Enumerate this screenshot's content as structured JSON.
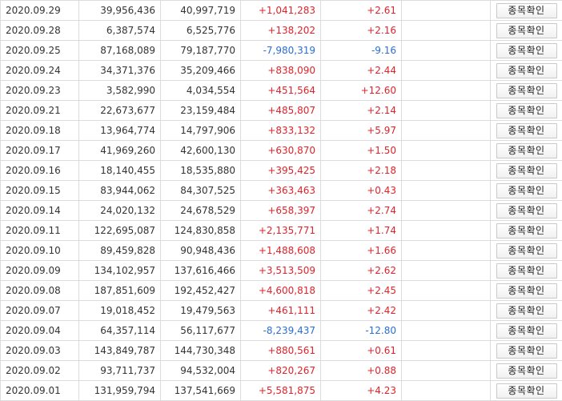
{
  "table": {
    "button_label": "종목확인",
    "rows": [
      {
        "date": "2020.09.29",
        "v1": "39,956,436",
        "v2": "40,997,719",
        "change": "+1,041,283",
        "rate": "+2.61",
        "dir": "pos"
      },
      {
        "date": "2020.09.28",
        "v1": "6,387,574",
        "v2": "6,525,776",
        "change": "+138,202",
        "rate": "+2.16",
        "dir": "pos"
      },
      {
        "date": "2020.09.25",
        "v1": "87,168,089",
        "v2": "79,187,770",
        "change": "-7,980,319",
        "rate": "-9.16",
        "dir": "neg"
      },
      {
        "date": "2020.09.24",
        "v1": "34,371,376",
        "v2": "35,209,466",
        "change": "+838,090",
        "rate": "+2.44",
        "dir": "pos"
      },
      {
        "date": "2020.09.23",
        "v1": "3,582,990",
        "v2": "4,034,554",
        "change": "+451,564",
        "rate": "+12.60",
        "dir": "pos"
      },
      {
        "date": "2020.09.21",
        "v1": "22,673,677",
        "v2": "23,159,484",
        "change": "+485,807",
        "rate": "+2.14",
        "dir": "pos"
      },
      {
        "date": "2020.09.18",
        "v1": "13,964,774",
        "v2": "14,797,906",
        "change": "+833,132",
        "rate": "+5.97",
        "dir": "pos"
      },
      {
        "date": "2020.09.17",
        "v1": "41,969,260",
        "v2": "42,600,130",
        "change": "+630,870",
        "rate": "+1.50",
        "dir": "pos"
      },
      {
        "date": "2020.09.16",
        "v1": "18,140,455",
        "v2": "18,535,880",
        "change": "+395,425",
        "rate": "+2.18",
        "dir": "pos"
      },
      {
        "date": "2020.09.15",
        "v1": "83,944,062",
        "v2": "84,307,525",
        "change": "+363,463",
        "rate": "+0.43",
        "dir": "pos"
      },
      {
        "date": "2020.09.14",
        "v1": "24,020,132",
        "v2": "24,678,529",
        "change": "+658,397",
        "rate": "+2.74",
        "dir": "pos"
      },
      {
        "date": "2020.09.11",
        "v1": "122,695,087",
        "v2": "124,830,858",
        "change": "+2,135,771",
        "rate": "+1.74",
        "dir": "pos"
      },
      {
        "date": "2020.09.10",
        "v1": "89,459,828",
        "v2": "90,948,436",
        "change": "+1,488,608",
        "rate": "+1.66",
        "dir": "pos"
      },
      {
        "date": "2020.09.09",
        "v1": "134,102,957",
        "v2": "137,616,466",
        "change": "+3,513,509",
        "rate": "+2.62",
        "dir": "pos"
      },
      {
        "date": "2020.09.08",
        "v1": "187,851,609",
        "v2": "192,452,427",
        "change": "+4,600,818",
        "rate": "+2.45",
        "dir": "pos"
      },
      {
        "date": "2020.09.07",
        "v1": "19,018,452",
        "v2": "19,479,563",
        "change": "+461,111",
        "rate": "+2.42",
        "dir": "pos"
      },
      {
        "date": "2020.09.04",
        "v1": "64,357,114",
        "v2": "56,117,677",
        "change": "-8,239,437",
        "rate": "-12.80",
        "dir": "neg"
      },
      {
        "date": "2020.09.03",
        "v1": "143,849,787",
        "v2": "144,730,348",
        "change": "+880,561",
        "rate": "+0.61",
        "dir": "pos"
      },
      {
        "date": "2020.09.02",
        "v1": "93,711,737",
        "v2": "94,532,004",
        "change": "+820,267",
        "rate": "+0.88",
        "dir": "pos"
      },
      {
        "date": "2020.09.01",
        "v1": "131,959,794",
        "v2": "137,541,669",
        "change": "+5,581,875",
        "rate": "+4.23",
        "dir": "pos"
      }
    ]
  },
  "colors": {
    "positive": "#e0232a",
    "negative": "#2a6ed8",
    "border": "#dcdcdc",
    "text": "#333333"
  }
}
